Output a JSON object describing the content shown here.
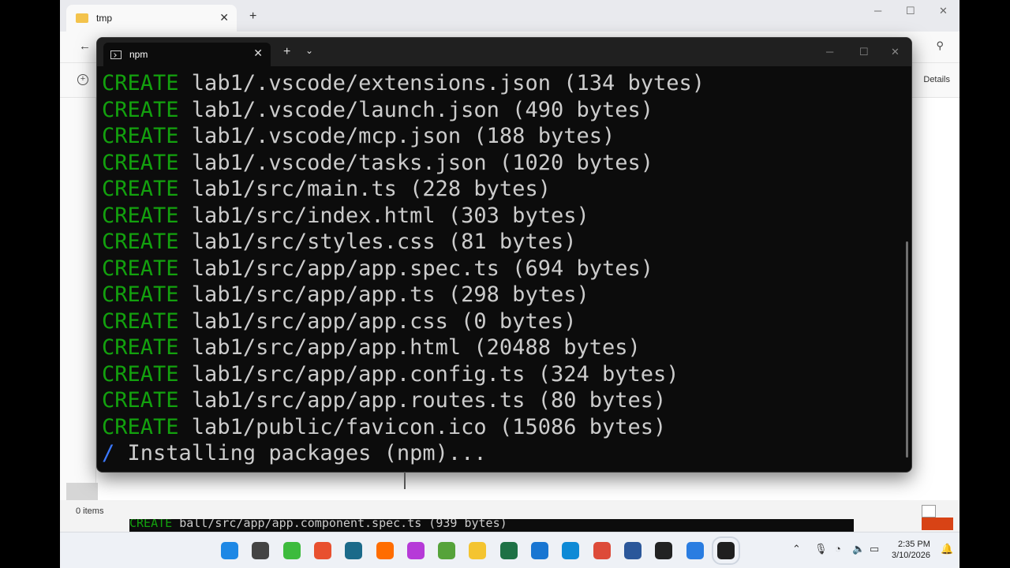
{
  "explorer": {
    "tab_title": "tmp",
    "details_label": "Details",
    "status_items": "0 items",
    "back_icon": "arrow-left-icon",
    "search_icon": "search-icon"
  },
  "terminal": {
    "tab_title": "npm",
    "keyword": "CREATE",
    "lines": [
      {
        "path": "lab1/.vscode/extensions.json (134 bytes)"
      },
      {
        "path": "lab1/.vscode/launch.json (490 bytes)"
      },
      {
        "path": "lab1/.vscode/mcp.json (188 bytes)"
      },
      {
        "path": "lab1/.vscode/tasks.json (1020 bytes)"
      },
      {
        "path": "lab1/src/main.ts (228 bytes)"
      },
      {
        "path": "lab1/src/index.html (303 bytes)"
      },
      {
        "path": "lab1/src/styles.css (81 bytes)"
      },
      {
        "path": "lab1/src/app/app.spec.ts (694 bytes)"
      },
      {
        "path": "lab1/src/app/app.ts (298 bytes)"
      },
      {
        "path": "lab1/src/app/app.css (0 bytes)"
      },
      {
        "path": "lab1/src/app/app.html (20488 bytes)"
      },
      {
        "path": "lab1/src/app/app.config.ts (324 bytes)"
      },
      {
        "path": "lab1/src/app/app.routes.ts (80 bytes)"
      },
      {
        "path": "lab1/public/favicon.ico (15086 bytes)"
      }
    ],
    "spinner": "/",
    "installing": "Installing packages (npm)...",
    "colors": {
      "keyword": "#13a10e",
      "text": "#cccccc",
      "spinner": "#3b78ff",
      "background": "#0c0c0c"
    }
  },
  "background_terminal": {
    "keyword": "CREATE",
    "text": "ball/src/app/app.component.spec.ts (939 bytes)"
  },
  "taskbar": {
    "time": "2:35 PM",
    "date": "3/10/2026",
    "apps": [
      "windows-start-icon",
      "task-view-icon",
      "spinner-app-icon",
      "chrome-canary-icon",
      "terminal-preview-icon",
      "firefox-icon",
      "copilot-icon",
      "notepad-icon",
      "file-explorer-icon",
      "excel-icon",
      "vscode-icon",
      "edge-icon",
      "chrome-icon",
      "word-icon",
      "obs-icon",
      "zalo-icon",
      "windows-terminal-icon"
    ],
    "badge": "N"
  }
}
